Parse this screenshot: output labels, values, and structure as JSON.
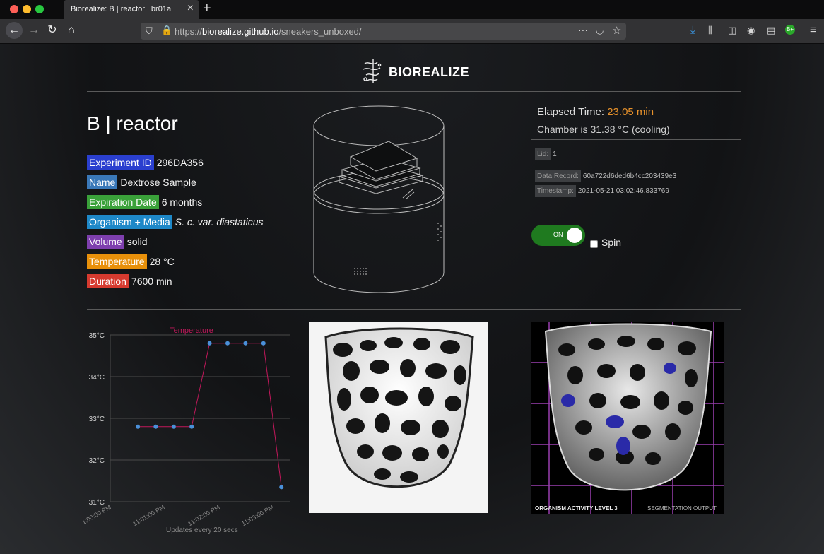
{
  "browser": {
    "tab_title": "Biorealize: B | reactor | br01a",
    "url_prefix": "https://",
    "url_domain": "biorealize.github.io",
    "url_path": "/sneakers_unboxed/",
    "profile_badge": "B+"
  },
  "header": {
    "logo_text": "BIOREALIZE"
  },
  "reactor": {
    "title": "B | reactor",
    "fields": [
      {
        "label": "Experiment ID",
        "value": "296DA356",
        "color": "#2a3fcf"
      },
      {
        "label": "Name",
        "value": "Dextrose Sample",
        "color": "#3a78b8"
      },
      {
        "label": "Expiration Date",
        "value": "6 months",
        "color": "#3aa13a"
      },
      {
        "label": "Organism + Media",
        "value": "S. c. var. diastaticus",
        "color": "#1e88c8"
      },
      {
        "label": "Volume",
        "value": "solid",
        "color": "#7e3fae"
      },
      {
        "label": "Temperature",
        "value": "28 °C",
        "color": "#e8900a"
      },
      {
        "label": "Duration",
        "value": "7600 min",
        "color": "#d63a2f"
      }
    ]
  },
  "status": {
    "elapsed_label": "Elapsed Time:",
    "elapsed_value": "23.05 min",
    "chamber_text": "Chamber is  31.38 °C (cooling)",
    "lid_label": "Lid:",
    "lid_value": "1",
    "record_label": "Data Record:",
    "record_value": "60a722d6ded6b4cc203439e3",
    "timestamp_label": "Timestamp:",
    "timestamp_value": "2021-05-21 03:02:46.833769",
    "toggle_label": "ON",
    "spin_label": "Spin"
  },
  "images": {
    "segmentation_left_label": "ORGANISM ACTIVITY LEVEL 3",
    "segmentation_right_label": "SEGMENTATION OUTPUT"
  },
  "chart_data": {
    "type": "line",
    "title": "Temperature",
    "ylim": [
      31,
      35
    ],
    "yticks": [
      31,
      32,
      33,
      34,
      35
    ],
    "ytick_labels": [
      "31°C",
      "32°C",
      "33°C",
      "34°C",
      "35°C"
    ],
    "xtick_labels": [
      "11:00:00 PM",
      "11:01:00 PM",
      "11:02:00 PM",
      "11:03:00 PM"
    ],
    "series": [
      {
        "name": "Temperature",
        "values": [
          32.8,
          32.8,
          32.8,
          32.8,
          34.8,
          34.8,
          34.8,
          34.8,
          31.35
        ]
      }
    ],
    "line_color": "#c2185b",
    "point_color": "#4a90d9",
    "grid": true,
    "footnote": "Updates every 20 secs"
  }
}
